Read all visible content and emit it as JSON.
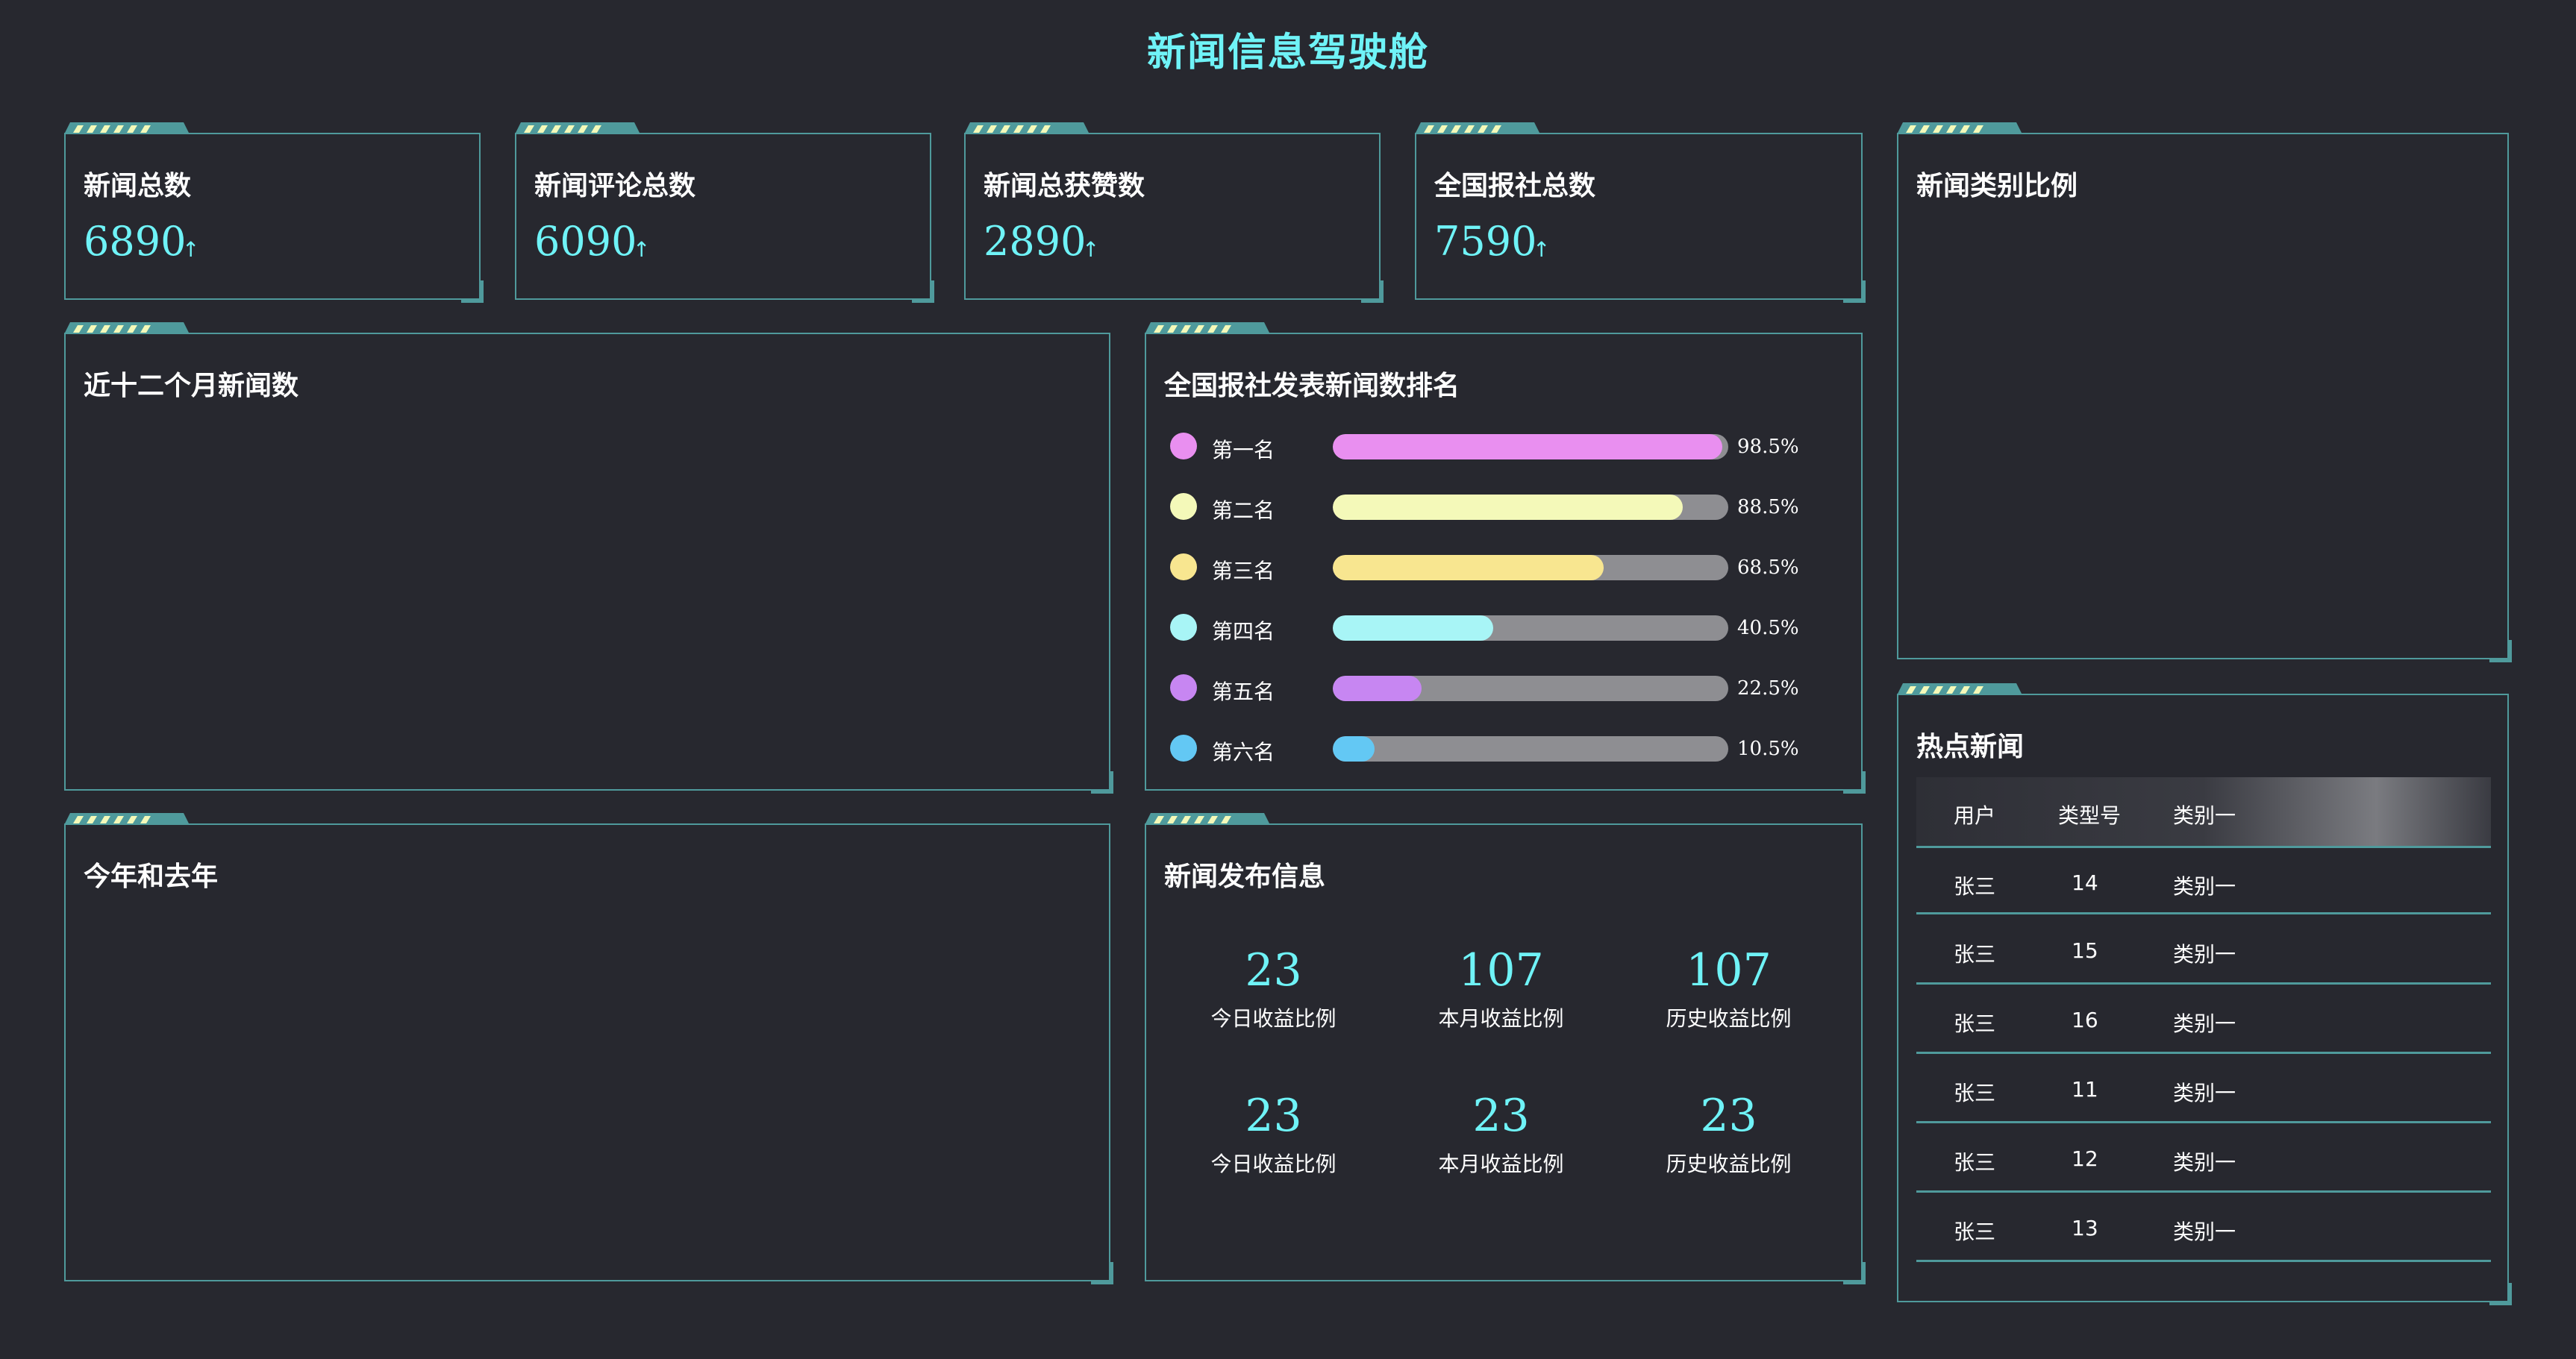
{
  "header": {
    "title": "新闻信息驾驶舱"
  },
  "stats": [
    {
      "label": "新闻总数",
      "value": "6890",
      "arrow": "↑"
    },
    {
      "label": "新闻评论总数",
      "value": "6090",
      "arrow": "↑"
    },
    {
      "label": "新闻总获赞数",
      "value": "2890",
      "arrow": "↑"
    },
    {
      "label": "全国报社总数",
      "value": "7590",
      "arrow": "↑"
    }
  ],
  "panels": {
    "category_ratio": "新闻类别比例",
    "monthly_news": "近十二个月新闻数",
    "ranking": "全国报社发表新闻数排名",
    "this_last_year": "今年和去年",
    "publish_info": "新闻发布信息",
    "hot_news": "热点新闻"
  },
  "ranking": [
    {
      "label": "第一名",
      "percent": 98.5,
      "percent_text": "98.5%",
      "color": "#e98ff0"
    },
    {
      "label": "第二名",
      "percent": 88.5,
      "percent_text": "88.5%",
      "color": "#f4f9b9"
    },
    {
      "label": "第三名",
      "percent": 68.5,
      "percent_text": "68.5%",
      "color": "#f8e690"
    },
    {
      "label": "第四名",
      "percent": 40.5,
      "percent_text": "40.5%",
      "color": "#a8f5f6"
    },
    {
      "label": "第五名",
      "percent": 22.5,
      "percent_text": "22.5%",
      "color": "#c786f2"
    },
    {
      "label": "第六名",
      "percent": 10.5,
      "percent_text": "10.5%",
      "color": "#63c8f4"
    }
  ],
  "publish_info": [
    {
      "value": "23",
      "label": "今日收益比例"
    },
    {
      "value": "107",
      "label": "本月收益比例"
    },
    {
      "value": "107",
      "label": "历史收益比例"
    },
    {
      "value": "23",
      "label": "今日收益比例"
    },
    {
      "value": "23",
      "label": "本月收益比例"
    },
    {
      "value": "23",
      "label": "历史收益比例"
    }
  ],
  "hot_news": {
    "columns": [
      "用户",
      "类型号",
      "类别一"
    ],
    "rows": [
      [
        "张三",
        "14",
        "类别一"
      ],
      [
        "张三",
        "15",
        "类别一"
      ],
      [
        "张三",
        "16",
        "类别一"
      ],
      [
        "张三",
        "11",
        "类别一"
      ],
      [
        "张三",
        "12",
        "类别一"
      ],
      [
        "张三",
        "13",
        "类别一"
      ]
    ]
  },
  "colors": {
    "accent": "#6ff3f7",
    "border": "#4f9a9c",
    "background": "#27282f"
  }
}
